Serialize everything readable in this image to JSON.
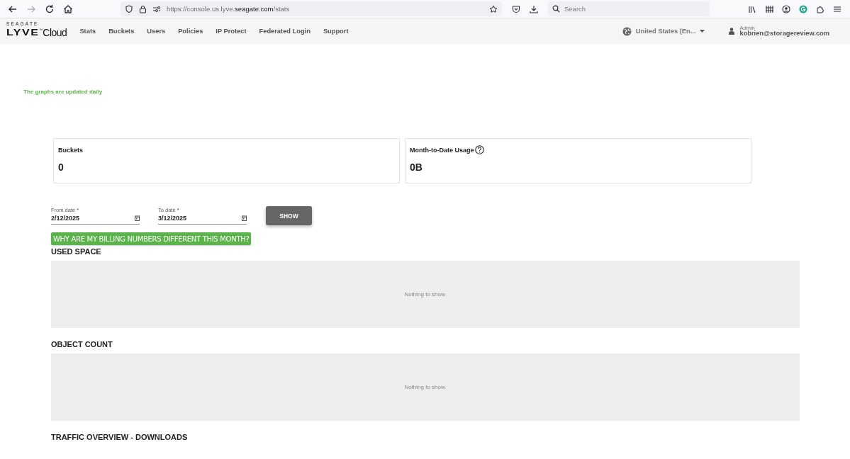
{
  "browser": {
    "nav_buttons": [
      {
        "kind": "back",
        "disabled": false
      },
      {
        "kind": "forward",
        "disabled": true
      },
      {
        "kind": "reload",
        "disabled": false
      },
      {
        "kind": "home",
        "disabled": false
      }
    ],
    "url": "https://console.us.lyve.**seagate.com**/stats",
    "search": {
      "placeholder": "Search"
    }
  },
  "header": {
    "logo": {
      "brand": "SEAGATE",
      "product": "LYVE",
      "mark": "™",
      "suffix": "Cloud"
    },
    "nav": [
      {
        "label": "Stats",
        "selected": false
      },
      {
        "label": "Buckets",
        "selected": false
      },
      {
        "label": "Users",
        "selected": false
      },
      {
        "label": "Policies",
        "selected": false
      },
      {
        "label": "IP Protect",
        "selected": false
      },
      {
        "label": "Federated Login",
        "selected": false
      },
      {
        "label": "Support",
        "selected": false
      }
    ],
    "region": "United States (En...",
    "user": {
      "role": "Admin",
      "email": "kobrien@storagereview.com"
    }
  },
  "notice": "The graphs are updated daily",
  "cards": [
    {
      "title": "Buckets",
      "value": "0",
      "help": false
    },
    {
      "title": "Month-to-Date Usage",
      "value": "0B",
      "help": true
    }
  ],
  "filters": {
    "from": {
      "label": "From date *",
      "value": "2/12/2025"
    },
    "to": {
      "label": "To date *",
      "value": "3/12/2025"
    },
    "button": "SHOW"
  },
  "billing_button": "WHY ARE MY BILLING NUMBERS DIFFERENT THIS MONTH?",
  "sections": [
    {
      "title": "USED SPACE",
      "empty_text": "Nothing to show."
    },
    {
      "title": "OBJECT COUNT",
      "empty_text": "Nothing to show."
    },
    {
      "title": "TRAFFIC OVERVIEW - DOWNLOADS"
    }
  ]
}
